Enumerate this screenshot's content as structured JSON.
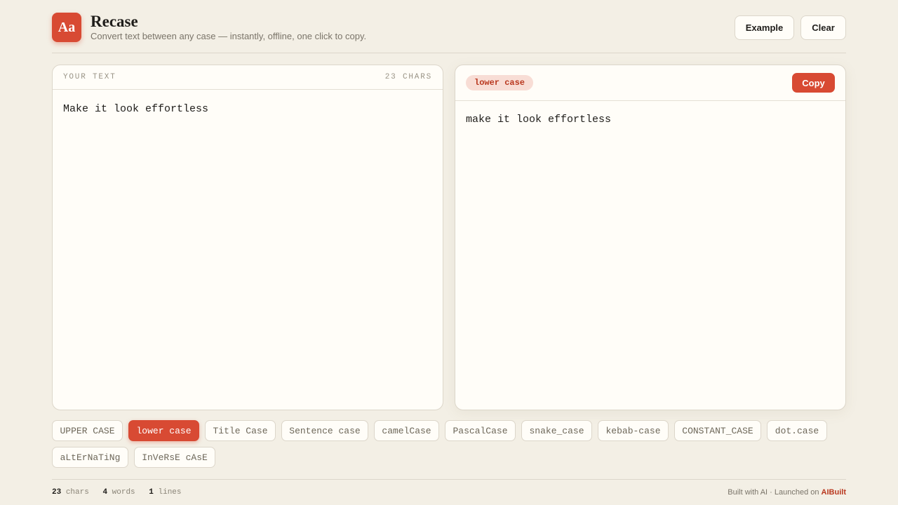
{
  "app": {
    "logo_text": "Aa",
    "title": "Recase",
    "subtitle": "Convert text between any case — instantly, offline, one click to copy."
  },
  "header": {
    "example_label": "Example",
    "clear_label": "Clear"
  },
  "input_panel": {
    "label": "YOUR TEXT",
    "count": "23 CHARS",
    "value": "Make it look effortless"
  },
  "output_panel": {
    "mode": "lower case",
    "copy_label": "Copy",
    "value": "make it look effortless"
  },
  "cases": [
    {
      "label": "UPPER CASE",
      "active": false
    },
    {
      "label": "lower case",
      "active": true
    },
    {
      "label": "Title Case",
      "active": false
    },
    {
      "label": "Sentence case",
      "active": false
    },
    {
      "label": "camelCase",
      "active": false
    },
    {
      "label": "PascalCase",
      "active": false
    },
    {
      "label": "snake_case",
      "active": false
    },
    {
      "label": "kebab-case",
      "active": false
    },
    {
      "label": "CONSTANT_CASE",
      "active": false
    },
    {
      "label": "dot.case",
      "active": false
    },
    {
      "label": "aLtErNaTiNg",
      "active": false
    },
    {
      "label": "InVeRsE cAsE",
      "active": false
    }
  ],
  "stats": {
    "chars_value": "23",
    "chars_label": "chars",
    "words_value": "4",
    "words_label": "words",
    "lines_value": "1",
    "lines_label": "lines"
  },
  "footer": {
    "credit_text": "Built with AI · Launched on",
    "credit_link": "AIBuilt"
  },
  "colors": {
    "accent": "#d84a33",
    "background": "#f3efe5",
    "panel": "#fffdf8"
  }
}
